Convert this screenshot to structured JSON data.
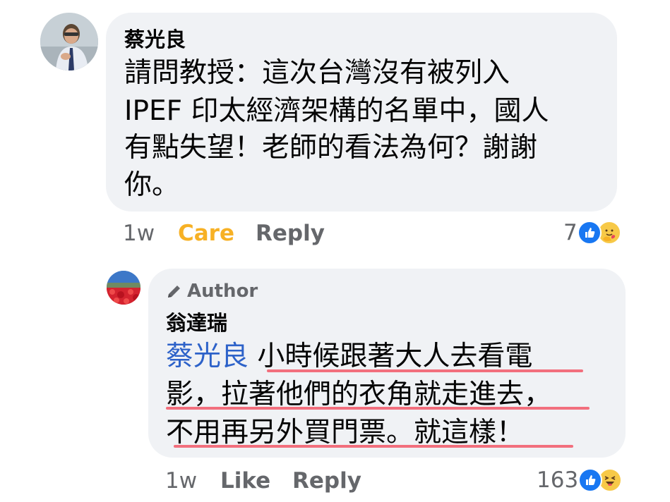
{
  "comment1": {
    "author": "蔡光良",
    "lines": [
      "請問教授：這次台灣沒有被列入",
      "IPEF 印太經濟架構的名單中，國人",
      "有點失望！老師的看法為何？謝謝",
      "你。"
    ],
    "time": "1w",
    "reaction_label": "Care",
    "reply_label": "Reply",
    "reaction_count": "7",
    "reaction_icons": [
      "like-icon",
      "care-icon"
    ]
  },
  "comment2": {
    "badge": "Author",
    "author": "翁達瑞",
    "mention": "蔡光良",
    "lines": [
      "小時候跟著大人去看電",
      "影，拉著他們的衣角就走進去，",
      "不用再另外買門票。就這樣！"
    ],
    "time": "1w",
    "like_label": "Like",
    "reply_label": "Reply",
    "reaction_count": "163",
    "reaction_icons": [
      "like-icon",
      "haha-icon"
    ],
    "highlight_color": "#f26f7d"
  }
}
